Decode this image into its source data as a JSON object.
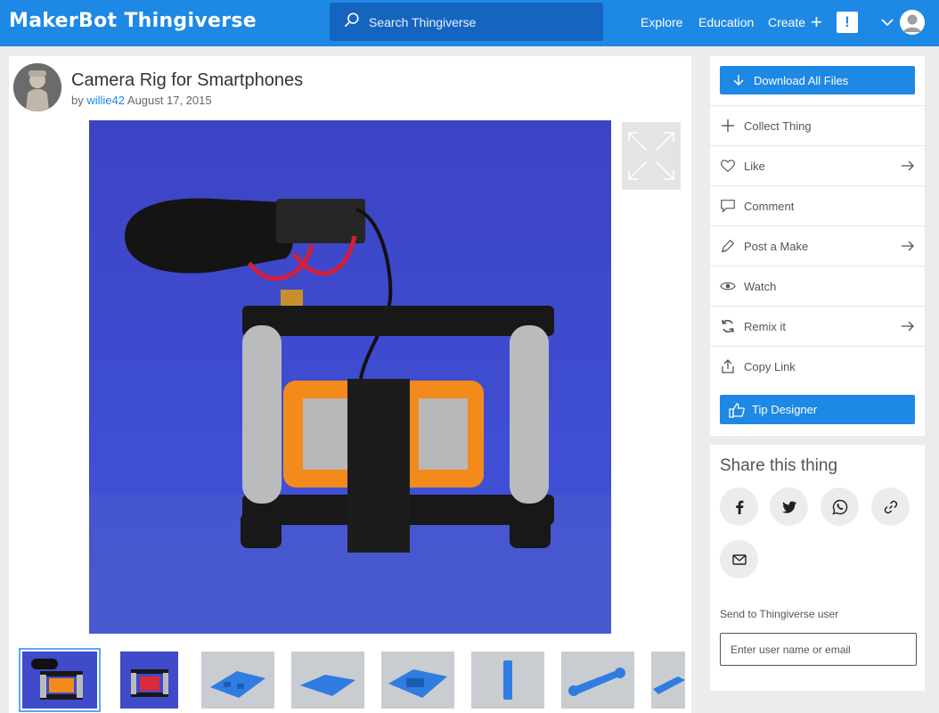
{
  "header": {
    "logo_part1": "MakerBot",
    "logo_part2": "Thingiverse",
    "search_placeholder": "Search Thingiverse",
    "nav": {
      "explore": "Explore",
      "education": "Education",
      "create": "Create",
      "create_icon": "plus-icon"
    },
    "alert_label": "!",
    "brand_color": "#1e88e5"
  },
  "thing": {
    "title": "Camera Rig for Smartphones",
    "by_label": "by",
    "author": "willie42",
    "date": "August 17, 2015"
  },
  "gallery": {
    "selected_index": 0,
    "thumbnails": [
      "thumb-1",
      "thumb-2",
      "thumb-3",
      "thumb-4",
      "thumb-5",
      "thumb-6",
      "thumb-7",
      "thumb-8"
    ]
  },
  "sidebar": {
    "download_label": "Download All Files",
    "actions": [
      {
        "label": "Collect Thing",
        "icon": "plus-icon",
        "has_arrow": false
      },
      {
        "label": "Like",
        "icon": "heart-icon",
        "has_arrow": true
      },
      {
        "label": "Comment",
        "icon": "comment-icon",
        "has_arrow": false
      },
      {
        "label": "Post a Make",
        "icon": "make-icon",
        "has_arrow": true
      },
      {
        "label": "Watch",
        "icon": "eye-icon",
        "has_arrow": false
      },
      {
        "label": "Remix it",
        "icon": "remix-icon",
        "has_arrow": true
      },
      {
        "label": "Copy Link",
        "icon": "share-icon",
        "has_arrow": false
      }
    ],
    "tip_label": "Tip Designer"
  },
  "share": {
    "title": "Share this thing",
    "networks": [
      "facebook-icon",
      "twitter-icon",
      "whatsapp-icon",
      "link-icon",
      "email-icon"
    ],
    "send_label": "Send to Thingiverse user",
    "send_placeholder": "Enter user name or email"
  }
}
